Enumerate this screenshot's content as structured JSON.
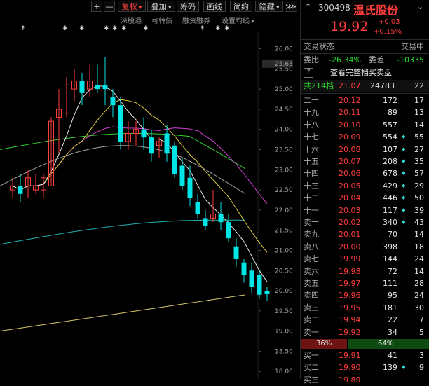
{
  "toolbar": {
    "plus": "+",
    "minus": "—",
    "adjust": "复权",
    "overlay": "叠加",
    "chips": "筹码",
    "draw": "画线",
    "simple": "简约",
    "hide": "隐藏",
    "expand": "⋙"
  },
  "subbar": {
    "items": [
      "深股通",
      "可转债",
      "融资融券",
      "设置均线"
    ]
  },
  "chart": {
    "price_ticks": [
      "26.00",
      "25.50",
      "25.00",
      "24.50",
      "24.00",
      "23.50",
      "23.00",
      "22.50",
      "22.00",
      "21.50",
      "21.00",
      "20.50",
      "20.00",
      "19.50",
      "19.00",
      "18.50",
      "18.00"
    ],
    "highlight_label": "25.63",
    "colors": {
      "up": "#ff3d3d",
      "down": "#00e5e5",
      "ma5": "#e6e6e6",
      "ma10": "#e0d040",
      "ma20": "#d040d0",
      "ma30": "#30d030",
      "ma60": "#a0a0a0",
      "ma120": "#20b0b0",
      "ma250": "#d8c870"
    }
  },
  "chart_data": {
    "type": "candlestick",
    "ylim": [
      17.9,
      26.2
    ],
    "candles": [
      {
        "o": 22.5,
        "h": 22.8,
        "l": 22.3,
        "c": 22.6
      },
      {
        "o": 22.6,
        "h": 22.9,
        "l": 22.2,
        "c": 22.4
      },
      {
        "o": 22.6,
        "h": 23.0,
        "l": 22.3,
        "c": 22.8
      },
      {
        "o": 22.5,
        "h": 22.9,
        "l": 22.4,
        "c": 22.6
      },
      {
        "o": 22.5,
        "h": 22.9,
        "l": 22.3,
        "c": 22.8
      },
      {
        "o": 22.6,
        "h": 24.3,
        "l": 22.6,
        "c": 24.2
      },
      {
        "o": 24.3,
        "h": 25.0,
        "l": 23.4,
        "c": 24.5
      },
      {
        "o": 24.4,
        "h": 25.3,
        "l": 24.3,
        "c": 25.1
      },
      {
        "o": 25.0,
        "h": 25.5,
        "l": 24.7,
        "c": 25.2
      },
      {
        "o": 25.2,
        "h": 25.4,
        "l": 24.6,
        "c": 24.9
      },
      {
        "o": 25.0,
        "h": 25.6,
        "l": 24.8,
        "c": 25.2
      },
      {
        "o": 25.1,
        "h": 25.6,
        "l": 24.9,
        "c": 25.0
      },
      {
        "o": 25.1,
        "h": 25.8,
        "l": 24.6,
        "c": 25.0
      },
      {
        "o": 24.8,
        "h": 25.0,
        "l": 24.3,
        "c": 24.6
      },
      {
        "o": 24.6,
        "h": 24.8,
        "l": 23.5,
        "c": 23.7
      },
      {
        "o": 23.7,
        "h": 24.2,
        "l": 23.5,
        "c": 23.9
      },
      {
        "o": 23.9,
        "h": 24.2,
        "l": 23.6,
        "c": 24.0
      },
      {
        "o": 24.0,
        "h": 24.3,
        "l": 23.5,
        "c": 23.8
      },
      {
        "o": 23.8,
        "h": 24.0,
        "l": 23.2,
        "c": 23.4
      },
      {
        "o": 23.6,
        "h": 23.8,
        "l": 23.3,
        "c": 23.7
      },
      {
        "o": 23.9,
        "h": 24.1,
        "l": 23.2,
        "c": 23.4
      },
      {
        "o": 23.6,
        "h": 23.7,
        "l": 22.8,
        "c": 22.9
      },
      {
        "o": 23.1,
        "h": 23.3,
        "l": 22.5,
        "c": 22.6
      },
      {
        "o": 22.8,
        "h": 23.1,
        "l": 22.1,
        "c": 22.3
      },
      {
        "o": 22.2,
        "h": 22.4,
        "l": 21.8,
        "c": 21.9
      },
      {
        "o": 21.8,
        "h": 22.0,
        "l": 21.5,
        "c": 21.6
      },
      {
        "o": 21.8,
        "h": 22.5,
        "l": 21.7,
        "c": 21.9
      },
      {
        "o": 21.9,
        "h": 22.2,
        "l": 21.5,
        "c": 21.7
      },
      {
        "o": 21.7,
        "h": 21.9,
        "l": 21.2,
        "c": 21.3
      },
      {
        "o": 21.1,
        "h": 21.3,
        "l": 20.6,
        "c": 20.8
      },
      {
        "o": 20.7,
        "h": 20.8,
        "l": 20.2,
        "c": 20.4
      },
      {
        "o": 20.5,
        "h": 20.7,
        "l": 19.95,
        "c": 20.1
      },
      {
        "o": 20.4,
        "h": 20.5,
        "l": 19.8,
        "c": 19.9
      },
      {
        "o": 20.0,
        "h": 20.1,
        "l": 19.75,
        "c": 19.92
      }
    ]
  },
  "stock": {
    "code": "300498",
    "name": "温氏股份",
    "price": "19.92",
    "change": "+0.03",
    "change_pct": "+0.15%"
  },
  "status": {
    "label": "交易状态",
    "value": "交易中",
    "ratio_label": "委比",
    "ratio": "-26.34%",
    "diff_label": "委差",
    "diff": "-10335",
    "help": "?",
    "view_all": "查看完整档买卖盘"
  },
  "depth_summary": {
    "total": "共214档",
    "price": "21.07",
    "vol": "24783",
    "count": "22"
  },
  "asks": [
    {
      "label": "二十",
      "price": "20.12",
      "vol": "172",
      "count": "17"
    },
    {
      "label": "十九",
      "price": "20.11",
      "vol": "89",
      "count": "13"
    },
    {
      "label": "十八",
      "price": "20.10",
      "vol": "557",
      "count": "14"
    },
    {
      "label": "十七",
      "price": "20.09",
      "vol": "554",
      "count": "55"
    },
    {
      "label": "十六",
      "price": "20.08",
      "vol": "107",
      "count": "27"
    },
    {
      "label": "十五",
      "price": "20.07",
      "vol": "208",
      "count": "35"
    },
    {
      "label": "十四",
      "price": "20.06",
      "vol": "678",
      "count": "57"
    },
    {
      "label": "十三",
      "price": "20.05",
      "vol": "429",
      "count": "29"
    },
    {
      "label": "十二",
      "price": "20.04",
      "vol": "446",
      "count": "50"
    },
    {
      "label": "十一",
      "price": "20.03",
      "vol": "117",
      "count": "39"
    },
    {
      "label": "卖十",
      "price": "20.02",
      "vol": "340",
      "count": "43"
    },
    {
      "label": "卖九",
      "price": "20.01",
      "vol": "70",
      "count": "14"
    },
    {
      "label": "卖八",
      "price": "20.00",
      "vol": "398",
      "count": "18"
    },
    {
      "label": "卖七",
      "price": "19.99",
      "vol": "144",
      "count": "24"
    },
    {
      "label": "卖六",
      "price": "19.98",
      "vol": "72",
      "count": "14"
    },
    {
      "label": "卖五",
      "price": "19.97",
      "vol": "111",
      "count": "28"
    },
    {
      "label": "卖四",
      "price": "19.96",
      "vol": "95",
      "count": "24"
    },
    {
      "label": "卖三",
      "price": "19.95",
      "vol": "181",
      "count": "30"
    },
    {
      "label": "卖二",
      "price": "19.94",
      "vol": "22",
      "count": "7"
    },
    {
      "label": "卖一",
      "price": "19.92",
      "vol": "34",
      "count": "5"
    }
  ],
  "ratio_bar": {
    "buy_pct": "36%",
    "sell_pct": "64%",
    "buy_fraction": 0.36
  },
  "bids": [
    {
      "label": "买一",
      "price": "19.91",
      "vol": "41",
      "count": "3"
    },
    {
      "label": "买二",
      "price": "19.90",
      "vol": "139",
      "count": "9"
    },
    {
      "label": "买三",
      "price": "19.89",
      "vol": "",
      "count": ""
    }
  ]
}
